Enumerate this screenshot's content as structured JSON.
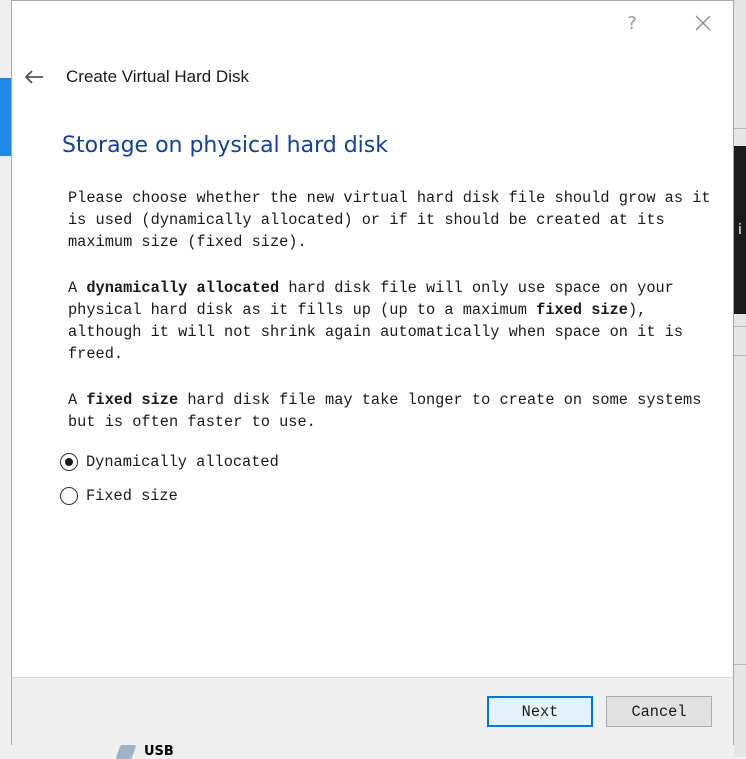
{
  "dialog": {
    "help_label": "?",
    "close_label": "✕",
    "wizard_title": "Create Virtual Hard Disk",
    "page_heading": "Storage on physical hard disk",
    "intro": "Please choose whether the new virtual hard disk file should grow as it is used (dynamically allocated) or if it should be created at its maximum size (fixed size).",
    "dynamic_para": {
      "p1": "A ",
      "b1": "dynamically allocated",
      "p2": " hard disk file will only use space on your physical hard disk as it fills up (up to a maximum ",
      "b2": "fixed size",
      "p3": "), although it will not shrink again automatically when space on it is freed."
    },
    "fixed_para": {
      "p1": "A ",
      "b1": "fixed size",
      "p2": " hard disk file may take longer to create on some systems but is often faster to use."
    },
    "options": [
      {
        "label": "Dynamically allocated",
        "selected": true
      },
      {
        "label": "Fixed size",
        "selected": false
      }
    ],
    "next_label": "Next",
    "cancel_label": "Cancel"
  },
  "background": {
    "usb_label": "USB",
    "dark_panel_glyph": "i"
  },
  "colors": {
    "heading": "#13409d",
    "accent_border": "#0078d7",
    "background_blue": "#1e88e5"
  }
}
